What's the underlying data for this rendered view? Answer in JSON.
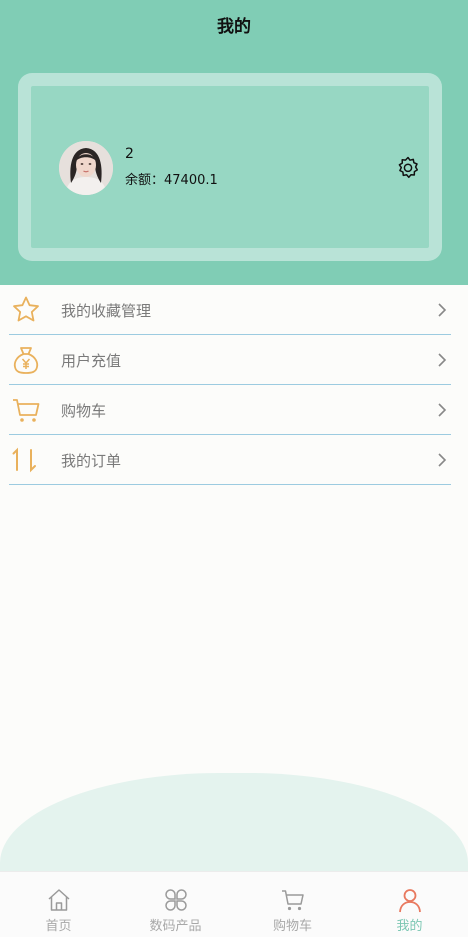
{
  "header": {
    "title": "我的"
  },
  "profile": {
    "username": "2",
    "balance_text": "余额：47400.1"
  },
  "menu": [
    {
      "label": "我的收藏管理",
      "icon": "star-icon"
    },
    {
      "label": "用户充值",
      "icon": "money-bag-icon"
    },
    {
      "label": "购物车",
      "icon": "cart-icon"
    },
    {
      "label": "我的订单",
      "icon": "order-arrows-icon"
    }
  ],
  "tabbar": {
    "items": [
      {
        "label": "首页",
        "icon": "home-icon"
      },
      {
        "label": "数码产品",
        "icon": "products-icon"
      },
      {
        "label": "购物车",
        "icon": "cart-icon"
      },
      {
        "label": "我的",
        "icon": "user-icon",
        "active": true
      }
    ]
  },
  "colors": {
    "header_bg": "#80cdb5",
    "card_bg": "#97d7c3",
    "icon_orange": "#e9b15c",
    "divider": "#9ccbe0",
    "active_tab": "#7cc7b3",
    "active_tab_icon": "#e8795f"
  }
}
